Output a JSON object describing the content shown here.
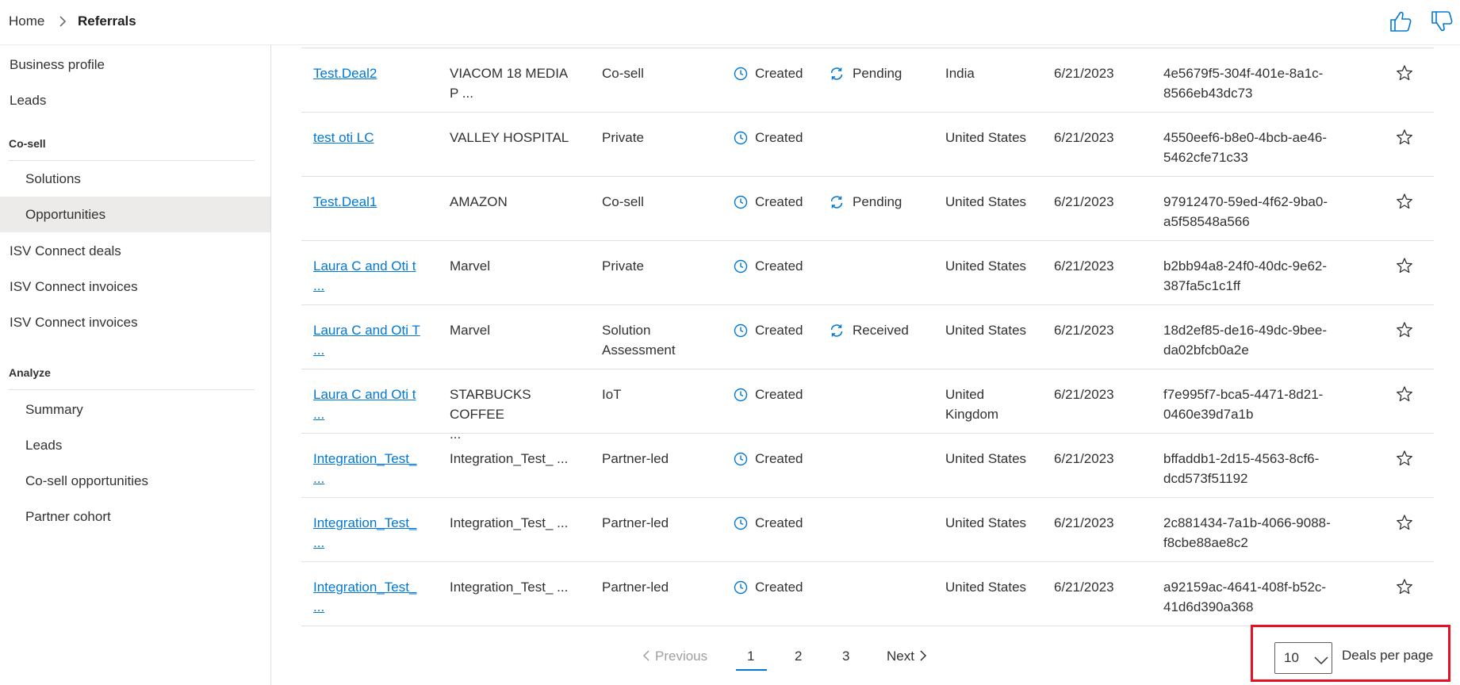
{
  "breadcrumb": {
    "home": "Home",
    "current": "Referrals"
  },
  "header_icons": [
    "thumbs-up-icon",
    "thumbs-down-icon"
  ],
  "sidebar": {
    "items": [
      {
        "label": "Business profile",
        "level": 1
      },
      {
        "label": "Leads",
        "level": 1
      },
      {
        "label": "Solutions",
        "level": 2
      },
      {
        "label": "Opportunities",
        "level": 2,
        "selected": true
      },
      {
        "label": "ISV Connect deals",
        "level": 1
      },
      {
        "label": "ISV Connect invoices",
        "level": 1
      },
      {
        "label": "ISV Connect invoices",
        "level": 1
      },
      {
        "label": "Summary",
        "level": 2
      },
      {
        "label": "Leads",
        "level": 2
      },
      {
        "label": "Co-sell opportunities",
        "level": 2
      },
      {
        "label": "Partner cohort",
        "level": 2
      }
    ],
    "groups": [
      "Co-sell",
      "Analyze"
    ]
  },
  "table": {
    "rows": [
      {
        "name": [
          "Test.Deal2"
        ],
        "customer": [
          "VIACOM 18 MEDIA",
          "P ..."
        ],
        "type": [
          "Co-sell"
        ],
        "status": "Created",
        "sub_status": "Pending",
        "country": [
          "India"
        ],
        "date": "6/21/2023",
        "id": [
          "4e5679f5-304f-401e-8a1c-",
          "8566eb43dc73"
        ]
      },
      {
        "name": [
          "test oti LC"
        ],
        "customer": [
          "VALLEY HOSPITAL"
        ],
        "type": [
          "Private"
        ],
        "status": "Created",
        "sub_status": "",
        "country": [
          "United States"
        ],
        "date": "6/21/2023",
        "id": [
          "4550eef6-b8e0-4bcb-ae46-",
          "5462cfe71c33"
        ]
      },
      {
        "name": [
          "Test.Deal1"
        ],
        "customer": [
          "AMAZON"
        ],
        "type": [
          "Co-sell"
        ],
        "status": "Created",
        "sub_status": "Pending",
        "country": [
          "United States"
        ],
        "date": "6/21/2023",
        "id": [
          "97912470-59ed-4f62-9ba0-",
          "a5f58548a566"
        ]
      },
      {
        "name": [
          "Laura C and Oti t",
          "..."
        ],
        "customer": [
          "Marvel"
        ],
        "type": [
          "Private"
        ],
        "status": "Created",
        "sub_status": "",
        "country": [
          "United States"
        ],
        "date": "6/21/2023",
        "id": [
          "b2bb94a8-24f0-40dc-9e62-",
          "387fa5c1c1ff"
        ]
      },
      {
        "name": [
          "Laura C and Oti T",
          "..."
        ],
        "customer": [
          "Marvel"
        ],
        "type": [
          "Solution",
          "Assessment"
        ],
        "status": "Created",
        "sub_status": "Received",
        "country": [
          "United States"
        ],
        "date": "6/21/2023",
        "id": [
          "18d2ef85-de16-49dc-9bee-",
          "da02bfcb0a2e"
        ]
      },
      {
        "name": [
          "Laura C and Oti t",
          "..."
        ],
        "customer": [
          "STARBUCKS COFFEE",
          "..."
        ],
        "type": [
          "IoT"
        ],
        "status": "Created",
        "sub_status": "",
        "country": [
          "United",
          "Kingdom"
        ],
        "date": "6/21/2023",
        "id": [
          "f7e995f7-bca5-4471-8d21-",
          "0460e39d7a1b"
        ]
      },
      {
        "name": [
          "Integration_Test_",
          "..."
        ],
        "customer": [
          "Integration_Test_ ..."
        ],
        "type": [
          "Partner-led"
        ],
        "status": "Created",
        "sub_status": "",
        "country": [
          "United States"
        ],
        "date": "6/21/2023",
        "id": [
          "bffaddb1-2d15-4563-8cf6-",
          "dcd573f51192"
        ]
      },
      {
        "name": [
          "Integration_Test_",
          "..."
        ],
        "customer": [
          "Integration_Test_ ..."
        ],
        "type": [
          "Partner-led"
        ],
        "status": "Created",
        "sub_status": "",
        "country": [
          "United States"
        ],
        "date": "6/21/2023",
        "id": [
          "2c881434-7a1b-4066-9088-",
          "f8cbe88ae8c2"
        ]
      },
      {
        "name": [
          "Integration_Test_",
          "..."
        ],
        "customer": [
          "Integration_Test_ ..."
        ],
        "type": [
          "Partner-led"
        ],
        "status": "Created",
        "sub_status": "",
        "country": [
          "United States"
        ],
        "date": "6/21/2023",
        "id": [
          "a92159ac-4641-408f-b52c-",
          "41d6d390a368"
        ]
      }
    ]
  },
  "pagination": {
    "previous": "Previous",
    "pages": [
      "1",
      "2",
      "3"
    ],
    "current_page": "1",
    "next": "Next"
  },
  "per_page": {
    "value": "10",
    "label": "Deals per page"
  },
  "colors": {
    "link": "#0078d4",
    "highlight_box": "#e81123",
    "selected_nav": "#edebe9"
  }
}
